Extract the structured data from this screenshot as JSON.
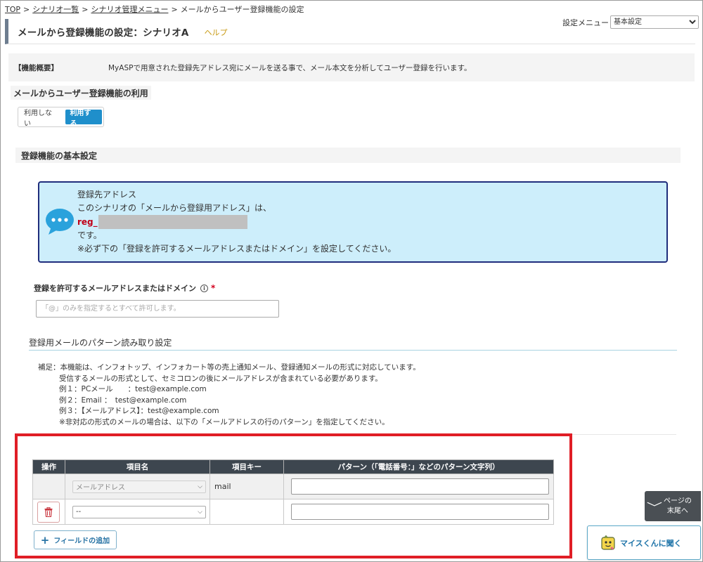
{
  "breadcrumb": {
    "items": [
      "TOP",
      "シナリオ一覧",
      "シナリオ管理メニュー"
    ],
    "current": "メールからユーザー登録機能の設定",
    "separator": ">"
  },
  "settings_menu": {
    "label": "設定メニュー",
    "selected": "基本設定"
  },
  "header": {
    "title": "メールから登録機能の設定：シナリオA",
    "help": "ヘルプ"
  },
  "overview": {
    "label": "【機能概要】",
    "text": "MyASPで用意された登録先アドレス宛にメールを送る事で、メール本文を分析してユーザー登録を行います。"
  },
  "usage": {
    "heading": "メールからユーザー登録機能の利用",
    "options": [
      "利用しない",
      "利用する"
    ],
    "selected": "利用する"
  },
  "basic_settings": {
    "heading": "登録機能の基本設定"
  },
  "info_box": {
    "title": "登録先アドレス",
    "line1": "このシナリオの「メールから登録用アドレス」は、",
    "address_prefix": "reg_",
    "line3": "です。",
    "line4": "※必ず下の「登録を許可するメールアドレスまたはドメイン」を設定してください。"
  },
  "allowed_domain": {
    "label": "登録を許可するメールアドレスまたはドメイン",
    "info_symbol": "i",
    "required_mark": "*",
    "placeholder": "「@」のみを指定するとすべて許可します。",
    "value": ""
  },
  "pattern_section": {
    "heading": "登録用メールのパターン読み取り設定",
    "notes": [
      "補足：本機能は、インフォトップ、インフォカート等の売上通知メール、登録通知メールの形式に対応しています。",
      "受信するメールの形式として、セミコロンの後にメールアドレスが含まれている必要があります。",
      "例１：PCメール　　：test@example.com",
      "例２：Email ：　test@example.com",
      "例３：【メールアドレス】：test@example.com",
      "※非対応の形式のメールの場合は、以下の「メールアドレスの行のパターン」を指定してください。"
    ]
  },
  "fields_table": {
    "headers": [
      "操作",
      "項目名",
      "項目キー",
      "パターン（「電話番号：」などのパターン文字列）"
    ],
    "rows": [
      {
        "name": "メールアドレス",
        "key": "mail",
        "pattern": ""
      },
      {
        "name": "--",
        "key": "",
        "pattern": ""
      }
    ]
  },
  "add_field_button": {
    "plus": "+",
    "label": "フィールドの追加"
  },
  "scroll_to_bottom": {
    "chevron": "﹀",
    "line1": "ページの",
    "line2": "末尾へ"
  },
  "ask_button": {
    "label": "マイスくんに聞く"
  },
  "colors": {
    "accent_blue": "#1f8fcb",
    "info_bg": "#cdeefb",
    "info_border": "#1f2d7c",
    "highlight_red": "#e01e26",
    "table_header": "#3d464f"
  }
}
